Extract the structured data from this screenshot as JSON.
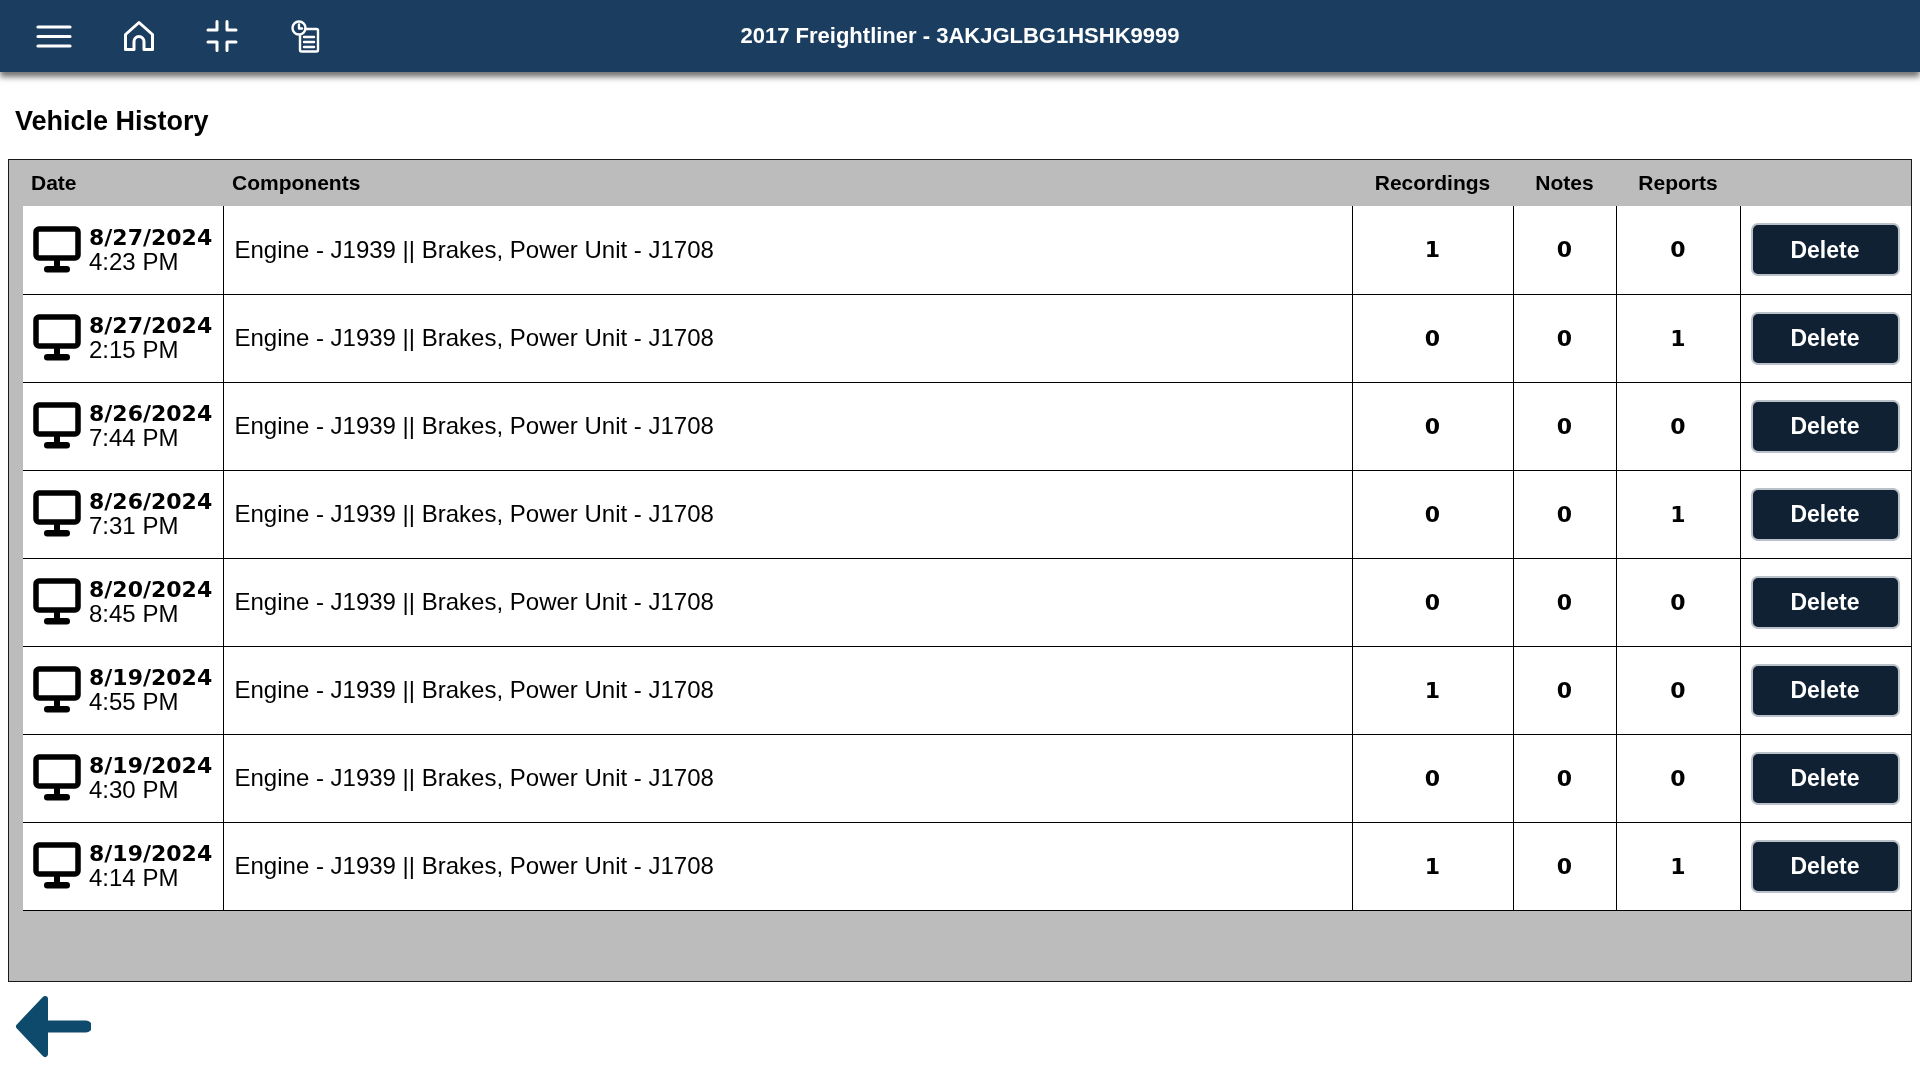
{
  "top_bar": {
    "title": "2017 Freightliner - 3AKJGLBG1HSHK9999"
  },
  "page_title": "Vehicle History",
  "history_table": {
    "columns": [
      "Date",
      "Components",
      "Recordings",
      "Notes",
      "Reports"
    ],
    "rows": [
      {
        "date": "8/27/2024",
        "time": "4:23 PM",
        "components": "Engine - J1939 || Brakes, Power Unit - J1708",
        "recordings": "1",
        "notes": "0",
        "reports": "0",
        "action": "Delete"
      },
      {
        "date": "8/27/2024",
        "time": "2:15 PM",
        "components": "Engine - J1939 || Brakes, Power Unit - J1708",
        "recordings": "0",
        "notes": "0",
        "reports": "1",
        "action": "Delete"
      },
      {
        "date": "8/26/2024",
        "time": "7:44 PM",
        "components": "Engine - J1939 || Brakes, Power Unit - J1708",
        "recordings": "0",
        "notes": "0",
        "reports": "0",
        "action": "Delete"
      },
      {
        "date": "8/26/2024",
        "time": "7:31 PM",
        "components": "Engine - J1939 || Brakes, Power Unit - J1708",
        "recordings": "0",
        "notes": "0",
        "reports": "1",
        "action": "Delete"
      },
      {
        "date": "8/20/2024",
        "time": "8:45 PM",
        "components": "Engine - J1939 || Brakes, Power Unit - J1708",
        "recordings": "0",
        "notes": "0",
        "reports": "0",
        "action": "Delete"
      },
      {
        "date": "8/19/2024",
        "time": "4:55 PM",
        "components": "Engine - J1939 || Brakes, Power Unit - J1708",
        "recordings": "1",
        "notes": "0",
        "reports": "0",
        "action": "Delete"
      },
      {
        "date": "8/19/2024",
        "time": "4:30 PM",
        "components": "Engine - J1939 || Brakes, Power Unit - J1708",
        "recordings": "0",
        "notes": "0",
        "reports": "0",
        "action": "Delete"
      },
      {
        "date": "8/19/2024",
        "time": "4:14 PM",
        "components": "Engine - J1939 || Brakes, Power Unit - J1708",
        "recordings": "1",
        "notes": "0",
        "reports": "1",
        "action": "Delete"
      }
    ]
  }
}
